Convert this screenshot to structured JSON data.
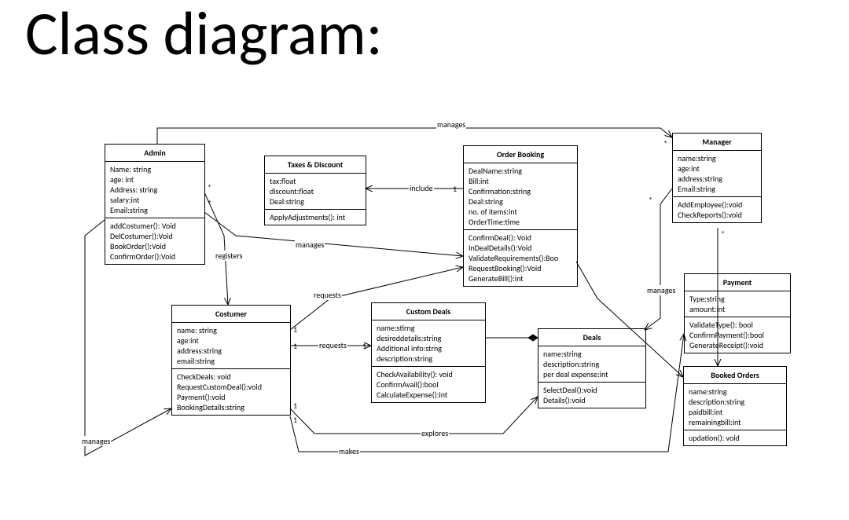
{
  "title": "Class diagram:",
  "classes": {
    "admin": {
      "name": "Admin",
      "attrs": [
        "Name: string",
        "age: int",
        "Address: string",
        "salary:int",
        "Email:string"
      ],
      "ops": [
        "addCostumer(): Void",
        "DelCostumer():Void",
        "BookOrder():Void",
        "ConfirmOrder():Void"
      ]
    },
    "taxes": {
      "name": "Taxes & Discount",
      "attrs": [
        "tax:float",
        "discount:float",
        "Deal:string"
      ],
      "ops": [
        "ApplyAdjustments(): int"
      ]
    },
    "order": {
      "name": "Order Booking",
      "attrs": [
        "DealName:string",
        "Bill:int",
        "Confirmation:string",
        "Deal:string",
        "no. of items:int",
        "OrderTime:time"
      ],
      "ops": [
        "ConfirmDeal(): Void",
        "InDealDetails():Void",
        "ValidateRequirements():Boo",
        "RequestBooking():Void",
        "GenerateBill():int"
      ]
    },
    "manager": {
      "name": "Manager",
      "attrs": [
        "name:string",
        "age:int",
        "address:string",
        "Email:string"
      ],
      "ops": [
        "AddEmployee():void",
        "CheckReports():void"
      ]
    },
    "costumer": {
      "name": "Costumer",
      "attrs": [
        "name: string",
        "age:int",
        "address:string",
        "email:string"
      ],
      "ops": [
        "CheckDeals: void",
        "RequestCustomDeal():void",
        "Payment():void",
        "BookingDetails:string"
      ]
    },
    "custom": {
      "name": "Custom Deals",
      "attrs": [
        "name:stirng",
        "desireddetails:string",
        "Additional info:strng",
        "description:string"
      ],
      "ops": [
        "CheckAvailability(): void",
        "ConfirmAvail():bool",
        "CalculateExpense():int"
      ]
    },
    "deals": {
      "name": "Deals",
      "attrs": [
        "name:string",
        "description:string",
        "per deal expense:int"
      ],
      "ops": [
        "SelectDeal():void",
        "Details():void"
      ]
    },
    "payment": {
      "name": "Payment",
      "attrs": [
        "Type:string",
        "amount:int"
      ],
      "ops": [
        "ValidateType(): bool",
        "ConfirmPayment():bool",
        "GenerateReceipt():void"
      ]
    },
    "booked": {
      "name": "Booked Orders",
      "attrs": [
        "name:string",
        "description:string",
        "paidbill:int",
        "remainingbill:int"
      ],
      "ops": [
        "updation(): void"
      ]
    }
  },
  "relations": {
    "manages_top": "manages",
    "include": "include",
    "registers": "registers",
    "manages_mid": "manages",
    "requests_up": "requests",
    "requests_mid": "requests",
    "manages_right": "manages",
    "explores": "explores",
    "makes": "makes",
    "manages_left": "manages"
  },
  "mults": {
    "admin_star_top": "*",
    "admin_star_mid": "*",
    "manager_star": "*",
    "order_one": "1",
    "cost_one_a": "1",
    "cost_one_b": "1",
    "cost_one_c": "1",
    "cost_one_d": "1",
    "custom_one": "1",
    "deals_star": "*",
    "manager_star2": "*"
  }
}
